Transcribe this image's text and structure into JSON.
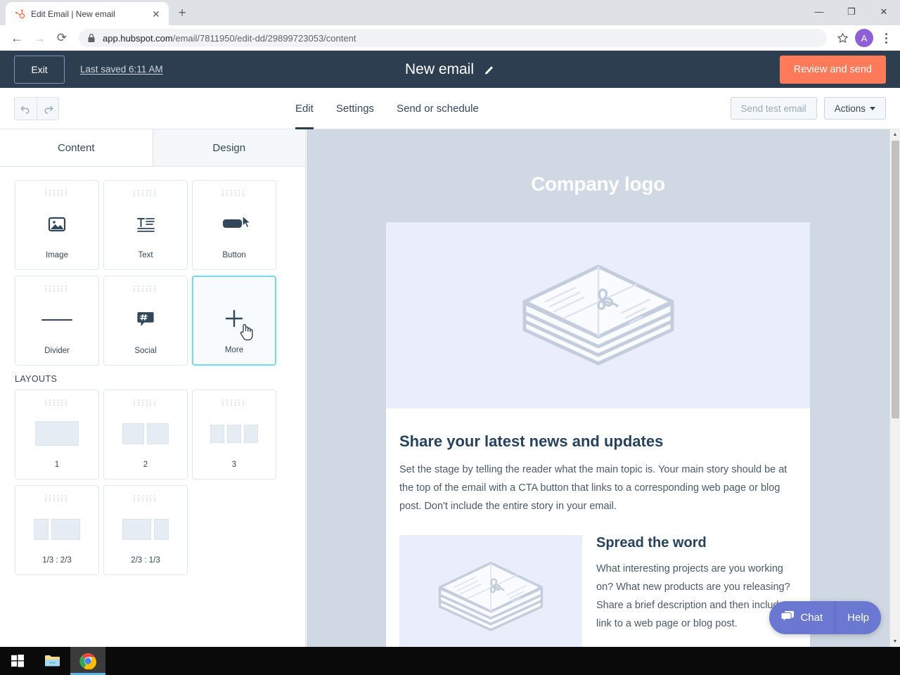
{
  "browser": {
    "tab": {
      "title": "Edit Email | New email",
      "favicon": "hubspot-sprocket-icon",
      "close": "✕"
    },
    "new_tab_label": "+",
    "window_controls": {
      "minimize": "—",
      "maximize": "❐",
      "close": "✕"
    },
    "nav": {
      "back": "←",
      "forward": "→",
      "reload": "⟳"
    },
    "url_secure": "app.hubspot.com",
    "url_path": "/email/7811950/edit-dd/29899723053/content",
    "profile_initial": "A"
  },
  "app_header": {
    "exit_label": "Exit",
    "last_saved": "Last saved 6:11 AM",
    "email_title": "New email",
    "review_and_send": "Review and send",
    "bg_color": "#2d3e50",
    "accent_color": "#ff7a59"
  },
  "subnav": {
    "tabs": [
      {
        "label": "Edit",
        "active": true
      },
      {
        "label": "Settings",
        "active": false
      },
      {
        "label": "Send or schedule",
        "active": false
      }
    ],
    "send_test_email": "Send test email",
    "actions": "Actions"
  },
  "left_panel": {
    "tabs": [
      {
        "label": "Content",
        "active": true
      },
      {
        "label": "Design",
        "active": false
      }
    ],
    "content_blocks": [
      {
        "label": "Image",
        "icon": "image-icon",
        "hover": false
      },
      {
        "label": "Text",
        "icon": "text-icon",
        "hover": false
      },
      {
        "label": "Button",
        "icon": "button-icon",
        "hover": false
      },
      {
        "label": "Divider",
        "icon": "divider-icon",
        "hover": false
      },
      {
        "label": "Social",
        "icon": "social-hashtag-icon",
        "hover": false
      },
      {
        "label": "More",
        "icon": "plus-icon",
        "hover": true
      }
    ],
    "layouts_heading": "LAYOUTS",
    "layouts": [
      {
        "label": "1",
        "columns": [
          1
        ]
      },
      {
        "label": "2",
        "columns": [
          1,
          1
        ]
      },
      {
        "label": "3",
        "columns": [
          1,
          1,
          1
        ]
      },
      {
        "label": "1/3 : 2/3",
        "columns": [
          1,
          2
        ]
      },
      {
        "label": "2/3 : 1/3",
        "columns": [
          2,
          1
        ]
      }
    ]
  },
  "preview": {
    "backdrop_color": "#cfd8e3",
    "company_logo": "Company logo",
    "hero_image_alt": "letter-stack-placeholder-icon",
    "section_heading": "Share your latest news and updates",
    "section_paragraph": "Set the stage by telling the reader what the main topic is. Your main story should be at the top of the email with a CTA button that links to a corresponding web page or blog post. Don't include the entire story in your email.",
    "split_image_alt": "letter-stack-placeholder-icon",
    "split_heading": "Spread the word",
    "split_paragraph": "What interesting projects are you working on? What new products are you releasing? Share a brief description and then include a link to a web page or blog post."
  },
  "chat_widget": {
    "chat_label": "Chat",
    "help_label": "Help",
    "color": "#6a78d1"
  },
  "taskbar": {
    "items": [
      {
        "name": "start-button",
        "active": false
      },
      {
        "name": "file-explorer",
        "active": false
      },
      {
        "name": "chrome",
        "active": true
      }
    ]
  }
}
